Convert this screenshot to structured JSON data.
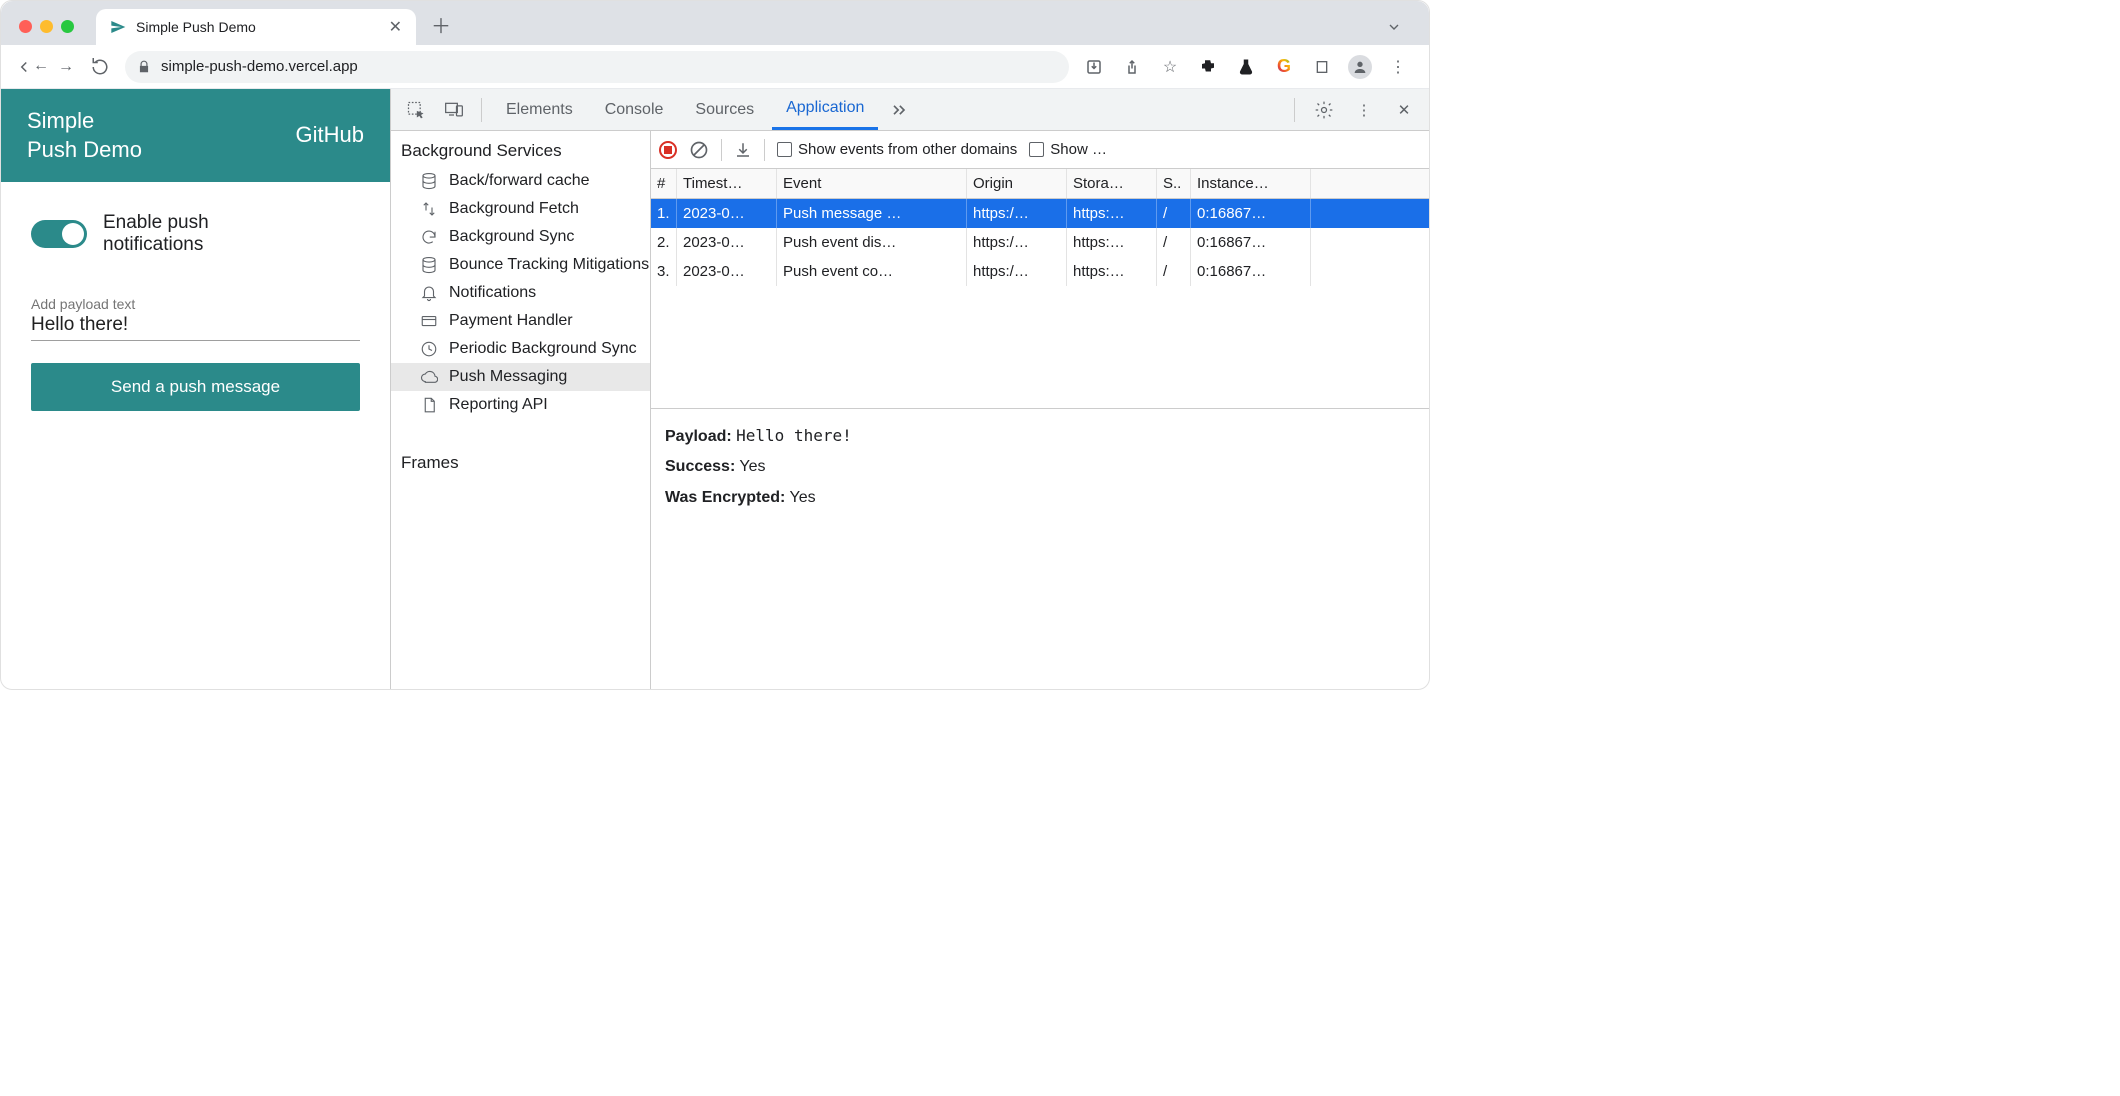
{
  "browser": {
    "tab_title": "Simple Push Demo",
    "url": "simple-push-demo.vercel.app"
  },
  "page": {
    "title_line1": "Simple",
    "title_line2": "Push Demo",
    "github": "GitHub",
    "toggle_line1": "Enable push",
    "toggle_line2": "notifications",
    "payload_label": "Add payload text",
    "payload_value": "Hello there!",
    "send_btn": "Send a push message"
  },
  "devtools": {
    "tabs": {
      "elements": "Elements",
      "console": "Console",
      "sources": "Sources",
      "application": "Application",
      "more": ""
    },
    "sidebar": {
      "section_bg": "Background Services",
      "items": [
        {
          "label": "Back/forward cache"
        },
        {
          "label": "Background Fetch"
        },
        {
          "label": "Background Sync"
        },
        {
          "label": "Bounce Tracking Mitigations"
        },
        {
          "label": "Notifications"
        },
        {
          "label": "Payment Handler"
        },
        {
          "label": "Periodic Background Sync"
        },
        {
          "label": "Push Messaging"
        },
        {
          "label": "Reporting API"
        }
      ],
      "section_frames": "Frames"
    },
    "toolbar": {
      "show_other": "Show events from other domains",
      "show_trunc": "Show …"
    },
    "columns": {
      "num": "#",
      "ts": "Timest…",
      "event": "Event",
      "origin": "Origin",
      "storage": "Stora…",
      "s": "S..",
      "inst": "Instance…"
    },
    "rows": [
      {
        "num": "1.",
        "ts": "2023-0…",
        "event": "Push message …",
        "origin": "https:/…",
        "storage": "https:…",
        "s": "/",
        "inst": "0:16867…"
      },
      {
        "num": "2.",
        "ts": "2023-0…",
        "event": "Push event dis…",
        "origin": "https:/…",
        "storage": "https:…",
        "s": "/",
        "inst": "0:16867…"
      },
      {
        "num": "3.",
        "ts": "2023-0…",
        "event": "Push event co…",
        "origin": "https:/…",
        "storage": "https:…",
        "s": "/",
        "inst": "0:16867…"
      }
    ],
    "details": {
      "payload_k": "Payload:",
      "payload_v": "Hello there!",
      "success_k": "Success:",
      "success_v": "Yes",
      "enc_k": "Was Encrypted:",
      "enc_v": "Yes"
    }
  }
}
